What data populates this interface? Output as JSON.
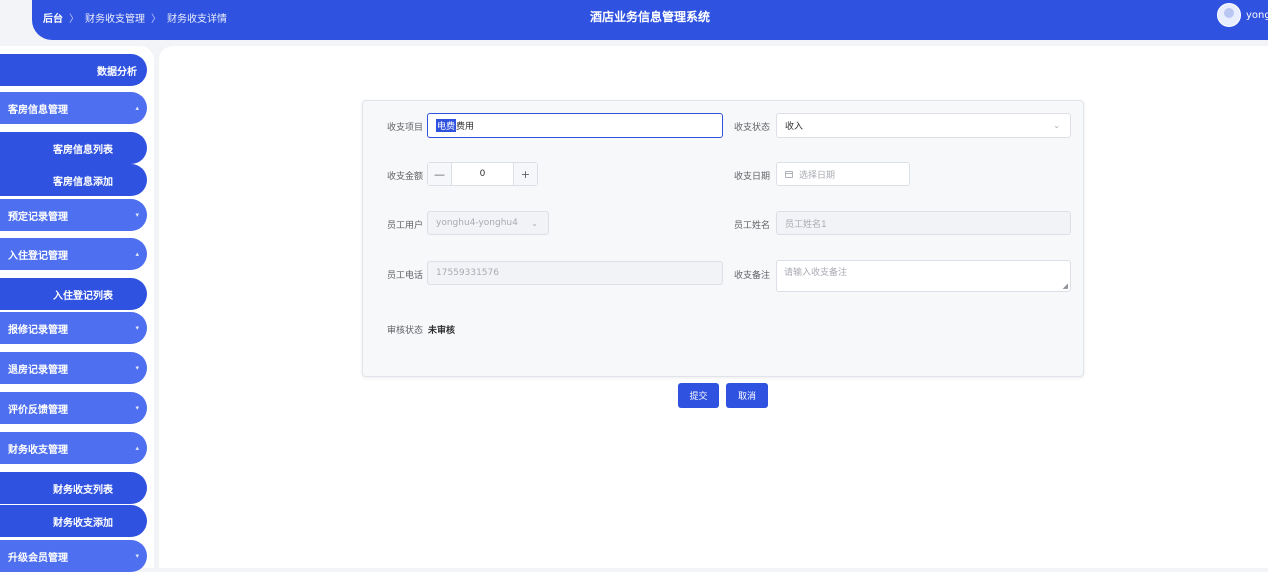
{
  "header": {
    "breadcrumb": [
      "后台",
      "财务收支管理",
      "财务收支详情"
    ],
    "breadcrumb_sep": "〉",
    "title": "酒店业务信息管理系统",
    "username": "yonghu"
  },
  "sidebar": {
    "items": [
      {
        "label": "数据分析",
        "arrow": ""
      },
      {
        "label": "客房信息管理",
        "arrow": "▴"
      },
      {
        "label": "客房信息列表",
        "arrow": ""
      },
      {
        "label": "客房信息添加",
        "arrow": ""
      },
      {
        "label": "预定记录管理",
        "arrow": "▾"
      },
      {
        "label": "入住登记管理",
        "arrow": "▴"
      },
      {
        "label": "入住登记列表",
        "arrow": ""
      },
      {
        "label": "报修记录管理",
        "arrow": "▾"
      },
      {
        "label": "退房记录管理",
        "arrow": "▾"
      },
      {
        "label": "评价反馈管理",
        "arrow": "▾"
      },
      {
        "label": "财务收支管理",
        "arrow": "▴"
      },
      {
        "label": "财务收支列表",
        "arrow": ""
      },
      {
        "label": "财务收支添加",
        "arrow": ""
      },
      {
        "label": "升级会员管理",
        "arrow": "▾"
      }
    ]
  },
  "form": {
    "item_label": "收支项目",
    "item_value_selected": "电费",
    "item_value_rest": "费用",
    "status_label": "收支状态",
    "status_value": "收入",
    "amount_label": "收支金额",
    "amount_value": "0",
    "minus": "—",
    "plus": "+",
    "date_label": "收支日期",
    "date_placeholder": "选择日期",
    "staff_user_label": "员工用户",
    "staff_user_value": "yonghu4-yonghu4",
    "staff_name_label": "员工姓名",
    "staff_name_value": "员工姓名1",
    "staff_phone_label": "员工电话",
    "staff_phone_value": "17559331576",
    "remark_label": "收支备注",
    "remark_placeholder": "请输入收支备注",
    "audit_label": "审核状态",
    "audit_value": "未审核",
    "chevron": "⌄"
  },
  "actions": {
    "submit": "提交",
    "cancel": "取消"
  }
}
